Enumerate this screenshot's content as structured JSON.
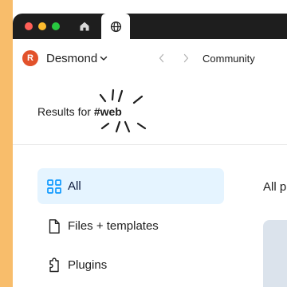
{
  "colors": {
    "backdrop": "#f8bd6b",
    "tabbar": "#1e1e1e",
    "avatar": "#e2522b",
    "active_filter_bg": "#e5f4ff",
    "accent_blue": "#0d99ff"
  },
  "tabs": [
    {
      "icon": "home-icon"
    },
    {
      "icon": "globe-icon",
      "active": true
    }
  ],
  "user": {
    "initial": "R",
    "name": "Desmond"
  },
  "nav": {
    "location": "Community"
  },
  "results": {
    "prefix": "Results for",
    "tag": "#web"
  },
  "filters": [
    {
      "label": "All",
      "icon": "grid-icon",
      "active": true
    },
    {
      "label": "Files + templates",
      "icon": "file-icon",
      "active": false
    },
    {
      "label": "Plugins",
      "icon": "plugin-icon",
      "active": false
    }
  ],
  "content": {
    "heading": "All p"
  }
}
